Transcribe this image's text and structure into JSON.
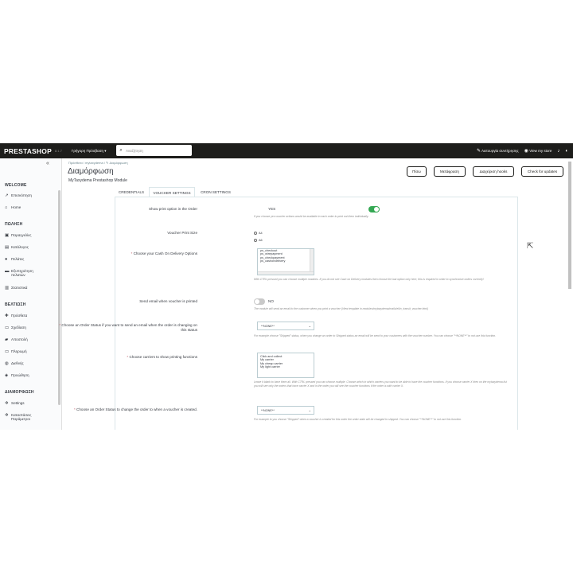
{
  "topbar": {
    "logo": "PRESTASHOP",
    "version": "8.1.7",
    "quick_access": "Γρήγορη Πρόσβαση ▾",
    "search_placeholder": "Αναζήτηση",
    "maintenance": "Λειτουργία συντήρησης",
    "view_store": "View my store"
  },
  "sidebar": {
    "sections": [
      {
        "title": "WELCOME",
        "items": [
          {
            "icon": "trend-icon",
            "glyph": "↗",
            "label": "Επισκόπηση"
          },
          {
            "icon": "home-icon",
            "glyph": "⌂",
            "label": "Home"
          }
        ]
      },
      {
        "title": "ΠΩΛΗΣΗ",
        "items": [
          {
            "icon": "orders-icon",
            "glyph": "▣",
            "label": "Παραγγελίες"
          },
          {
            "icon": "catalog-icon",
            "glyph": "▤",
            "label": "Κατάλογος"
          },
          {
            "icon": "customers-icon",
            "glyph": "●",
            "label": "Πελάτες"
          },
          {
            "icon": "support-icon",
            "glyph": "▬",
            "label": "Εξυπηρέτηση πελατών"
          },
          {
            "icon": "stats-icon",
            "glyph": "▥",
            "label": "Στατιστικά"
          }
        ]
      },
      {
        "title": "ΒΕΛΤΙΩΣΗ",
        "items": [
          {
            "icon": "modules-icon",
            "glyph": "✚",
            "label": "Πρόσθετα"
          },
          {
            "icon": "design-icon",
            "glyph": "▭",
            "label": "Σχεδίαση"
          },
          {
            "icon": "shipping-icon",
            "glyph": "▰",
            "label": "Αποστολή"
          },
          {
            "icon": "payment-icon",
            "glyph": "▭",
            "label": "Πληρωμή"
          },
          {
            "icon": "international-icon",
            "glyph": "◍",
            "label": "Διεθνής"
          },
          {
            "icon": "promotions-icon",
            "glyph": "◈",
            "label": "Προώθηση"
          }
        ]
      },
      {
        "title": "ΔΙΑΜΟΡΦΩΣΗ",
        "items": [
          {
            "icon": "settings-icon",
            "glyph": "✲",
            "label": "Settings"
          },
          {
            "icon": "advanced-icon",
            "glyph": "✲",
            "label": "Καταστάσεις Παράμετροι"
          }
        ]
      }
    ]
  },
  "header": {
    "breadcrumb": "Πρόσθετα  /  mytaxydema  /  ✎ Διαμόρφωση",
    "title": "Διαμόρφωση",
    "subtitle": "MyTaxydema Prestashop Module",
    "buttons": [
      "Πίσω",
      "Μετάφραση",
      "Διαχείριση hooks",
      "Check for updates"
    ]
  },
  "tabs": [
    "CREDENTIALS",
    "VOUCHER SETTINGS",
    "CRON SETTINGS"
  ],
  "form": {
    "show_print_label": "Show print option in the Order",
    "show_print_value": "YES",
    "show_print_help": "If you choose yes voucher actions would be available in each order to print out them individually.",
    "print_size_label": "Voucher Print Size",
    "print_size_options": [
      "A4",
      "A6"
    ],
    "cod_label": "Choose your Cash On Delivery Options",
    "cod_options": [
      "ps_checkout",
      "ps_wirepayment",
      "ps_checkpayment",
      "ps_cashondelivery"
    ],
    "cod_help": "With CTRL pressed you can choose multiple modules. If you do not see Cash on Delivery modules then choose the last option only here, this is required in order to synchronize orders correctly!",
    "email_label": "Send email when voucher is printed",
    "email_value": "NO",
    "email_help": "The module will send an email to the customer when you print a voucher (View template in modules/mytaxydema/mails/el/in_transit_voucher.html)",
    "status_email_label": "Choose an Order Status if you want to send an email when the order is changing on this status",
    "status_email_value": "**NONE**",
    "status_email_help": "For example choose \"Shipped\" status, when you change an order to Shipped status an email will be send to your customers with the voucher number. You can choose \"**NONE**\" to not use this function.",
    "carriers_label": "Choose carriers to show printing functions",
    "carriers_options": [
      "Click and collect",
      "My carrier",
      "My cheap carrier",
      "My light carrier"
    ],
    "carriers_help": "Leave it blank to have them all. With CTRL pressed you can choose multiple. Choose which in which carriers you want to be able to have the voucher functions. If you choose carrier X then on the mytaxydema list you will see only the orders that have carrier X and in the order you will see the voucher functions if the order is with carrier X.",
    "status_change_label": "Choose an Order Status to change the order to when a voucher is created.",
    "status_change_value": "**NONE**",
    "status_change_help": "For example to you choose \"Shipped\" when a voucher is created for this order the order state will be changed to shipped. You can choose \"**NONE**\" to not use this function."
  },
  "colors": {
    "topbar": "#1d1d1b",
    "toggle_on": "#34a853",
    "toggle_off": "#c9c9c9"
  }
}
